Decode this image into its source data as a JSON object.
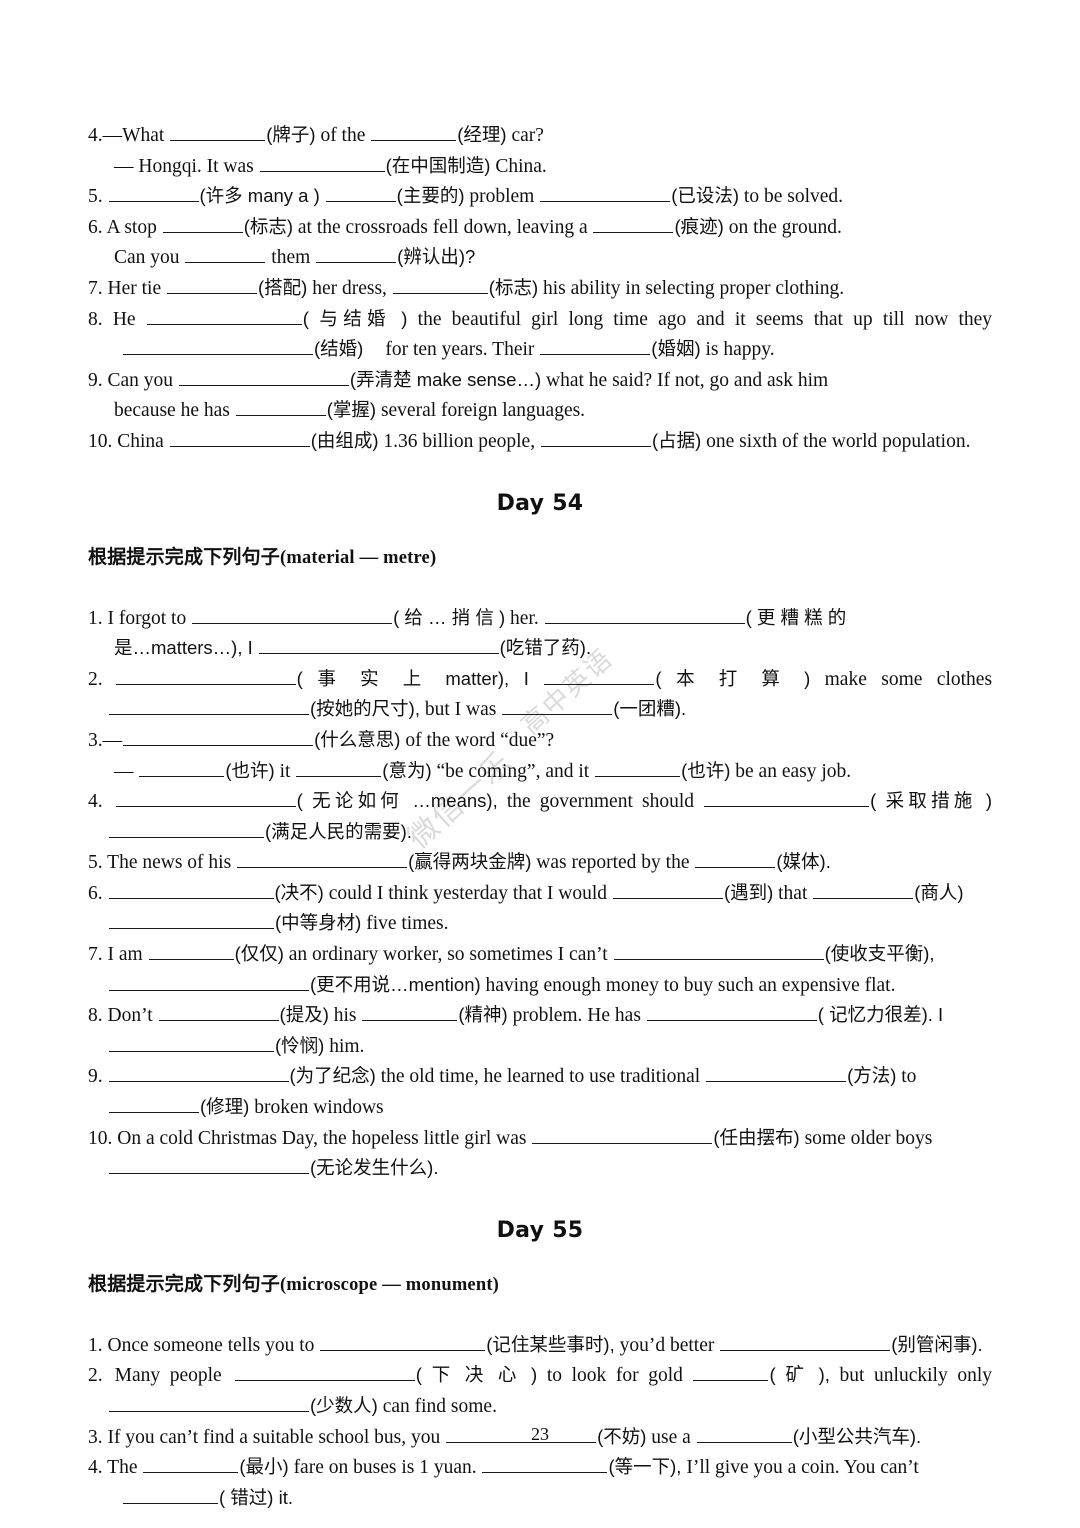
{
  "document": {
    "page_number": "23",
    "watermark_line1": "微信一乐",
    "watermark_line2": "高中英语"
  },
  "prev_day_tail": {
    "items": [
      {
        "number": "4.",
        "lines": [
          "— What ______(牌子) of the ______(经理) car?",
          "— Hongqi. It was ______(在中国制造) China."
        ]
      },
      {
        "number": "5.",
        "lines": [
          "______(许多 many a ) ______(主要的) problem ______(已设法) to be solved."
        ]
      },
      {
        "number": "6.",
        "lines": [
          "A stop ______(标志) at the crossroads fell down, leaving a ______(痕迹) on the ground.",
          "Can you ______ them ______(辨认出)?"
        ]
      },
      {
        "number": "7.",
        "lines": [
          "Her tie ______(搭配) her dress, ______(标志) his ability in selecting proper clothing."
        ]
      },
      {
        "number": "8.",
        "lines": [
          "He ______( 与结婚 ) the beautiful girl long time ago and it seems that up till now they",
          "______(结婚) for ten years. Their ______(婚姻) is happy."
        ]
      },
      {
        "number": "9.",
        "lines": [
          "Can you ______(弄清楚 make sense…) what he said? If not, go and ask him",
          "because he has ______(掌握) several foreign languages."
        ]
      },
      {
        "number": "10.",
        "lines": [
          "China ______(由组成) 1.36 billion people, ______(占据) one sixth of the world population."
        ]
      }
    ],
    "labels": {
      "q4_l1_a": "What",
      "q4_l1_hint1": "(牌子)",
      "q4_l1_mid": "of the",
      "q4_l1_hint2": "(经理)",
      "q4_l1_end": "car?",
      "q4_l2_a": "— Hongqi. It was",
      "q4_l2_hint": "(在中国制造)",
      "q4_l2_end": "China.",
      "q5_hint1": "(许多 many a )",
      "q5_hint2": "(主要的)",
      "q5_mid": "problem",
      "q5_hint3": "(已设法)",
      "q5_end": "to be solved.",
      "q6_a": "A stop",
      "q6_hint1": "(标志)",
      "q6_mid": "at the crossroads fell down, leaving a",
      "q6_hint2": "(痕迹)",
      "q6_end": "on the ground.",
      "q6_l2_a": "Can you",
      "q6_l2_mid": "them",
      "q6_l2_hint": "(辨认出)?",
      "q7_a": "Her tie",
      "q7_hint1": "(搭配)",
      "q7_mid": "her dress,",
      "q7_hint2": "(标志)",
      "q7_end": "his ability in selecting proper clothing.",
      "q8_a": "He",
      "q8_hint1": "( 与结婚 )",
      "q8_mid": "the beautiful girl long time ago and it seems that up till now they",
      "q8_l2_hint": "(结婚)",
      "q8_l2_mid": "for ten years. Their",
      "q8_l2_hint2": "(婚姻)",
      "q8_l2_end": "is happy.",
      "q9_a": "Can you",
      "q9_hint1": "(弄清楚 make sense…)",
      "q9_mid": "what he said? If not, go and ask him",
      "q9_l2_a": "because he has",
      "q9_l2_hint": "(掌握)",
      "q9_l2_end": "several foreign languages.",
      "q10_a": "China",
      "q10_hint1": "(由组成)",
      "q10_mid": "1.36 billion people,",
      "q10_hint2": "(占据)",
      "q10_end": "one sixth of the world population."
    }
  },
  "day54": {
    "title": "Day 54",
    "instruction_cn": "根据提示完成下列句子",
    "instruction_en": "(material — metre)",
    "labels": {
      "q1_a": "I forgot to",
      "q1_hint1": "( 给 … 捎 信 )",
      "q1_mid": "her.",
      "q1_hint2": "( 更 糟 糕 的",
      "q1_l2_hint2b": "是…matters…), I",
      "q1_l2_hint3": "(吃错了药).",
      "q2_hint1": "( 事 实 上 matter), I",
      "q2_hint2": "( 本 打 算 )",
      "q2_end": "make some clothes",
      "q2_l2_hint": "(按她的尺寸),",
      "q2_l2_mid": "but I was",
      "q2_l2_hint2": "(一团糟).",
      "q3_dash": "—",
      "q3_hint1": "(什么意思)",
      "q3_mid": "of the word “due”?",
      "q3_l2_dash": "—",
      "q3_l2_hint1": "(也许)",
      "q3_l2_a": "it",
      "q3_l2_hint2": "(意为)",
      "q3_l2_mid": "“be coming”, and it",
      "q3_l2_hint3": "(也许)",
      "q3_l2_end": "be an easy job.",
      "q4_hint1": "( 无论如何 …means),",
      "q4_mid": "the government should",
      "q4_hint2": "( 采取措施 )",
      "q4_l2_hint": "(满足人民的需要).",
      "q5_a": "The news of his",
      "q5_hint1": "(赢得两块金牌)",
      "q5_mid": "was reported by the",
      "q5_hint2": "(媒体).",
      "q6_hint1": "(决不)",
      "q6_mid": "could I think yesterday that I would",
      "q6_hint2": "(遇到)",
      "q6_mid2": "that",
      "q6_hint3": "(商人)",
      "q6_l2_hint": "(中等身材)",
      "q6_l2_end": "five times.",
      "q7_a": "I am",
      "q7_hint1": "(仅仅)",
      "q7_mid": "an ordinary worker, so sometimes I can’t",
      "q7_hint2": "(使收支平衡),",
      "q7_l2_hint": "(更不用说…mention)",
      "q7_l2_end": "having enough money to buy such an expensive flat.",
      "q8_a": "Don’t",
      "q8_hint1": "(提及)",
      "q8_mid": "his",
      "q8_hint2": "(精神)",
      "q8_mid2": "problem. He has",
      "q8_hint3": "( 记忆力很差). I",
      "q8_l2_hint": "(怜悯)",
      "q8_l2_end": "him.",
      "q9_hint1": "(为了纪念)",
      "q9_mid": "the old time, he learned to use traditional",
      "q9_hint2": "(方法)",
      "q9_end": "to",
      "q9_l2_hint": "(修理)",
      "q9_l2_end": "broken windows",
      "q10_a": "On a cold Christmas Day, the hopeless little girl was",
      "q10_hint1": "(任由摆布)",
      "q10_mid": "some older boys",
      "q10_l2_hint": "(无论发生什么)."
    },
    "numbers": {
      "n1": "1.",
      "n2": "2.",
      "n3": "3.",
      "n4": "4.",
      "n5": "5.",
      "n6": "6.",
      "n7": "7.",
      "n8": "8.",
      "n9": "9.",
      "n10": "10."
    }
  },
  "day55": {
    "title": "Day 55",
    "instruction_cn": "根据提示完成下列句子",
    "instruction_en": "(microscope — monument)",
    "labels": {
      "q1_a": "Once someone tells you to",
      "q1_hint1": "(记住某些事时),",
      "q1_mid": "you’d better",
      "q1_hint2": "(别管闲事).",
      "q2_a": "Many people",
      "q2_hint1": "( 下 决 心 )",
      "q2_mid": "to look for gold",
      "q2_hint2": "( 矿 ),",
      "q2_end": "but unluckily only",
      "q2_l2_hint": "(少数人)",
      "q2_l2_end": "can find some.",
      "q3_a": "If you can’t find a suitable school bus, you",
      "q3_hint1": "(不妨)",
      "q3_mid": "use a",
      "q3_hint2": "(小型公共汽车).",
      "q4_a": "The",
      "q4_hint1": "(最小)",
      "q4_mid": "fare on buses is 1 yuan.",
      "q4_hint2": "(等一下),",
      "q4_end": "I’ll give you a coin. You can’t",
      "q4_l2_hint": "( 错过) it."
    },
    "numbers": {
      "n1": "1.",
      "n2": "2.",
      "n3": "3.",
      "n4": "4."
    }
  }
}
